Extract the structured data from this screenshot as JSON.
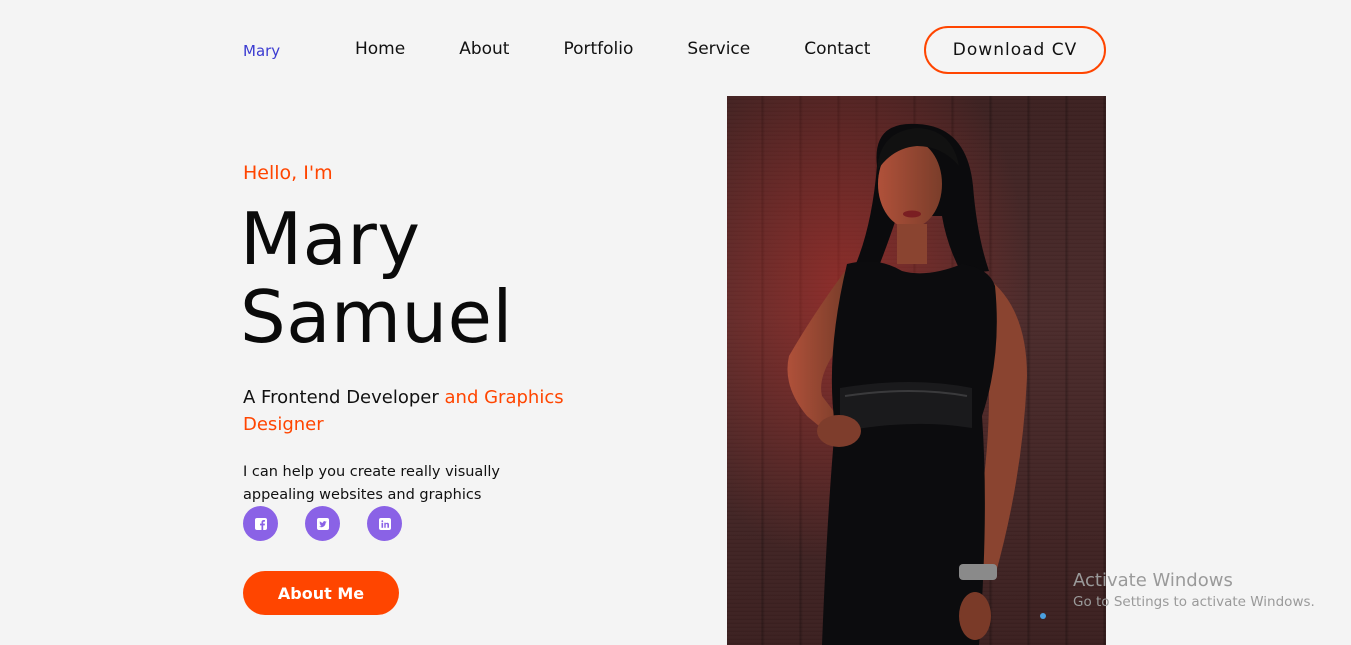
{
  "nav": {
    "logo": "Mary",
    "links": [
      "Home",
      "About",
      "Portfolio",
      "Service",
      "Contact"
    ],
    "cta_label": "Download CV"
  },
  "hero": {
    "greeting": "Hello, I'm",
    "first_name": "Mary",
    "last_name": "Samuel",
    "role_plain": "A Frontend Developer",
    "role_accent": "and Graphics Designer",
    "description": "I can help you create really visually appealing websites and graphics",
    "button_label": "About Me",
    "socials": [
      "facebook-icon",
      "twitter-icon",
      "linkedin-icon"
    ]
  },
  "watermark": {
    "title": "Activate Windows",
    "subtitle": "Go to Settings to activate Windows."
  },
  "colors": {
    "accent": "#ff4500",
    "social_bg": "#8a62e6",
    "logo": "#3b3bd1",
    "background": "#f4f4f4"
  }
}
